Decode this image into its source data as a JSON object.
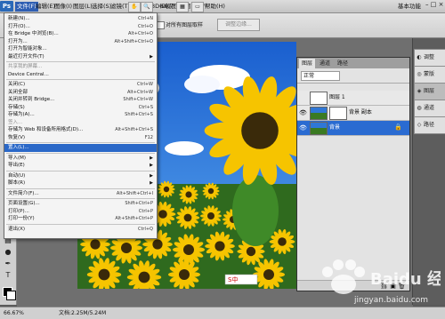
{
  "menubar": {
    "items": [
      "文件(F)",
      "编辑(E)",
      "图像(I)",
      "图层(L)",
      "选择(S)",
      "滤镜(T)",
      "分析(A)",
      "3D(D)",
      "视图(V)",
      "窗口(W)",
      "帮助(H)"
    ],
    "active_index": 0,
    "zoom": "66.7",
    "workspace": "基本功能"
  },
  "optbar": {
    "checkbox_label": "对所有图层取样",
    "button_label": "调整边缘..."
  },
  "file_menu": [
    {
      "label": "新建(N)...",
      "shortcut": "Ctrl+N"
    },
    {
      "label": "打开(O)...",
      "shortcut": "Ctrl+O"
    },
    {
      "label": "在 Bridge 中浏览(B)...",
      "shortcut": "Alt+Ctrl+O"
    },
    {
      "label": "打开为...",
      "shortcut": "Alt+Shift+Ctrl+O"
    },
    {
      "label": "打开为智能对象...",
      "shortcut": ""
    },
    {
      "label": "最近打开文件(T)",
      "shortcut": "",
      "submenu": true
    },
    {
      "sep": true
    },
    {
      "label": "共享我的屏幕...",
      "shortcut": "",
      "disabled": true
    },
    {
      "label": "Device Central...",
      "shortcut": ""
    },
    {
      "sep": true
    },
    {
      "label": "关闭(C)",
      "shortcut": "Ctrl+W"
    },
    {
      "label": "关闭全部",
      "shortcut": "Alt+Ctrl+W"
    },
    {
      "label": "关闭并转到 Bridge...",
      "shortcut": "Shift+Ctrl+W"
    },
    {
      "label": "存储(S)",
      "shortcut": "Ctrl+S"
    },
    {
      "label": "存储为(A)...",
      "shortcut": "Shift+Ctrl+S"
    },
    {
      "label": "签入...",
      "shortcut": "",
      "disabled": true
    },
    {
      "label": "存储为 Web 和设备所用格式(D)...",
      "shortcut": "Alt+Shift+Ctrl+S"
    },
    {
      "label": "恢复(V)",
      "shortcut": "F12"
    },
    {
      "sep": true
    },
    {
      "label": "置入(L)...",
      "shortcut": "",
      "highlighted": true
    },
    {
      "sep": true
    },
    {
      "label": "导入(M)",
      "shortcut": "",
      "submenu": true
    },
    {
      "label": "导出(E)",
      "shortcut": "",
      "submenu": true
    },
    {
      "sep": true
    },
    {
      "label": "自动(U)",
      "shortcut": "",
      "submenu": true
    },
    {
      "label": "脚本(R)",
      "shortcut": "",
      "submenu": true
    },
    {
      "sep": true
    },
    {
      "label": "文件简介(F)...",
      "shortcut": "Alt+Shift+Ctrl+I"
    },
    {
      "sep": true
    },
    {
      "label": "页面设置(G)...",
      "shortcut": "Shift+Ctrl+P"
    },
    {
      "label": "打印(P)...",
      "shortcut": "Ctrl+P"
    },
    {
      "label": "打印一份(Y)",
      "shortcut": "Alt+Shift+Ctrl+P"
    },
    {
      "sep": true
    },
    {
      "label": "退出(X)",
      "shortcut": "Ctrl+Q"
    }
  ],
  "layers_panel": {
    "tabs": [
      "图层",
      "通道",
      "路径"
    ],
    "blend_mode": "正常",
    "layers": [
      {
        "name": "图层 1",
        "visible": false,
        "selected": false
      },
      {
        "name": "背景 副本",
        "visible": true,
        "selected": false
      },
      {
        "name": "背景",
        "visible": true,
        "selected": true
      }
    ]
  },
  "dock": {
    "items": [
      {
        "label": "调整",
        "icon": "adjust-icon"
      },
      {
        "label": "蒙版",
        "icon": "mask-icon"
      },
      {
        "label": "图层",
        "icon": "layers-icon"
      },
      {
        "label": "通道",
        "icon": "channels-icon"
      },
      {
        "label": "路径",
        "icon": "paths-icon"
      }
    ]
  },
  "statusbar": {
    "zoom": "66.67%",
    "doc_info": "文档:2.25M/5.24M"
  },
  "ime_bar": "S中",
  "watermark": {
    "brand": "Baidu 经验",
    "url": "jingyan.baidu.com"
  }
}
